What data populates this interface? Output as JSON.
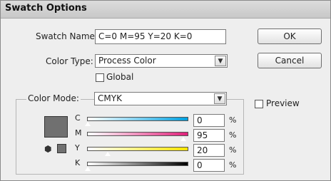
{
  "dialog": {
    "title": "Swatch Options"
  },
  "swatch_name": {
    "label": "Swatch Name:",
    "value": "C=0 M=95 Y=20 K=0"
  },
  "color_type": {
    "label": "Color Type:",
    "value": "Process Color"
  },
  "global": {
    "label": "Global",
    "checked": false
  },
  "color_mode": {
    "label": "Color Mode:",
    "value": "CMYK"
  },
  "buttons": {
    "ok": "OK",
    "cancel": "Cancel"
  },
  "preview": {
    "label": "Preview",
    "checked": false
  },
  "sliders": [
    {
      "channel": "C",
      "value": "0",
      "unit": "%",
      "gradient": [
        "#ffffff",
        "#00a0e0"
      ]
    },
    {
      "channel": "M",
      "value": "95",
      "unit": "%",
      "gradient": [
        "#ffffff",
        "#e0207a"
      ]
    },
    {
      "channel": "Y",
      "value": "20",
      "unit": "%",
      "gradient": [
        "#ffffff",
        "#ffe600"
      ]
    },
    {
      "channel": "K",
      "value": "0",
      "unit": "%",
      "gradient": [
        "#ffffff",
        "#000000"
      ]
    }
  ],
  "swatch_color": "#707070",
  "icons": {
    "gamut_warning": "cube-icon",
    "dropdown": "chevron-down-icon"
  }
}
